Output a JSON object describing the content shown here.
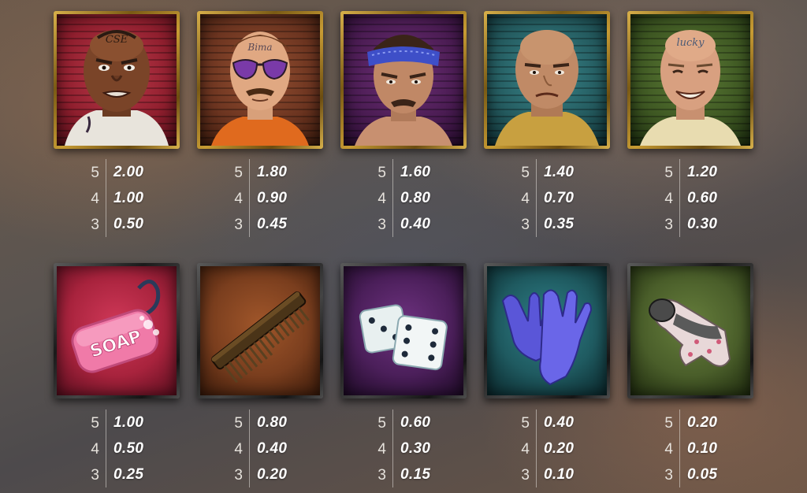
{
  "symbols": [
    {
      "name": "tattooed-inmate",
      "pays": [
        {
          "count": "5",
          "value": "2.00"
        },
        {
          "count": "4",
          "value": "1.00"
        },
        {
          "count": "3",
          "value": "0.50"
        }
      ]
    },
    {
      "name": "sunglasses-inmate",
      "pays": [
        {
          "count": "5",
          "value": "1.80"
        },
        {
          "count": "4",
          "value": "0.90"
        },
        {
          "count": "3",
          "value": "0.45"
        }
      ]
    },
    {
      "name": "bandana-inmate",
      "pays": [
        {
          "count": "5",
          "value": "1.60"
        },
        {
          "count": "4",
          "value": "0.80"
        },
        {
          "count": "3",
          "value": "0.40"
        }
      ]
    },
    {
      "name": "bald-inmate",
      "pays": [
        {
          "count": "5",
          "value": "1.40"
        },
        {
          "count": "4",
          "value": "0.70"
        },
        {
          "count": "3",
          "value": "0.35"
        }
      ]
    },
    {
      "name": "lucky-inmate",
      "pays": [
        {
          "count": "5",
          "value": "1.20"
        },
        {
          "count": "4",
          "value": "0.60"
        },
        {
          "count": "3",
          "value": "0.30"
        }
      ]
    },
    {
      "name": "soap",
      "pays": [
        {
          "count": "5",
          "value": "1.00"
        },
        {
          "count": "4",
          "value": "0.50"
        },
        {
          "count": "3",
          "value": "0.25"
        }
      ]
    },
    {
      "name": "comb",
      "pays": [
        {
          "count": "5",
          "value": "0.80"
        },
        {
          "count": "4",
          "value": "0.40"
        },
        {
          "count": "3",
          "value": "0.20"
        }
      ]
    },
    {
      "name": "dice",
      "pays": [
        {
          "count": "5",
          "value": "0.60"
        },
        {
          "count": "4",
          "value": "0.30"
        },
        {
          "count": "3",
          "value": "0.15"
        }
      ]
    },
    {
      "name": "gloves",
      "pays": [
        {
          "count": "5",
          "value": "0.40"
        },
        {
          "count": "4",
          "value": "0.20"
        },
        {
          "count": "3",
          "value": "0.10"
        }
      ]
    },
    {
      "name": "sock",
      "pays": [
        {
          "count": "5",
          "value": "0.20"
        },
        {
          "count": "4",
          "value": "0.10"
        },
        {
          "count": "3",
          "value": "0.05"
        }
      ]
    }
  ],
  "tattoo_texts": {
    "inmate1": "CSE",
    "inmate2": "Bima",
    "inmate5": "lucky"
  },
  "soap_text": "SOAP",
  "colors": {
    "inmate1_bg": "#8f1f2e",
    "inmate2_bg": "#6b3420",
    "inmate3_bg": "#4a1c52",
    "inmate4_bg": "#245a5e",
    "inmate5_bg": "#3d5622",
    "soap_bg": "#a8233d",
    "comb_bg": "#7a3e1e",
    "dice_bg": "#4b1f5a",
    "gloves_bg": "#1f5a60",
    "sock_bg": "#4a5e2a"
  }
}
